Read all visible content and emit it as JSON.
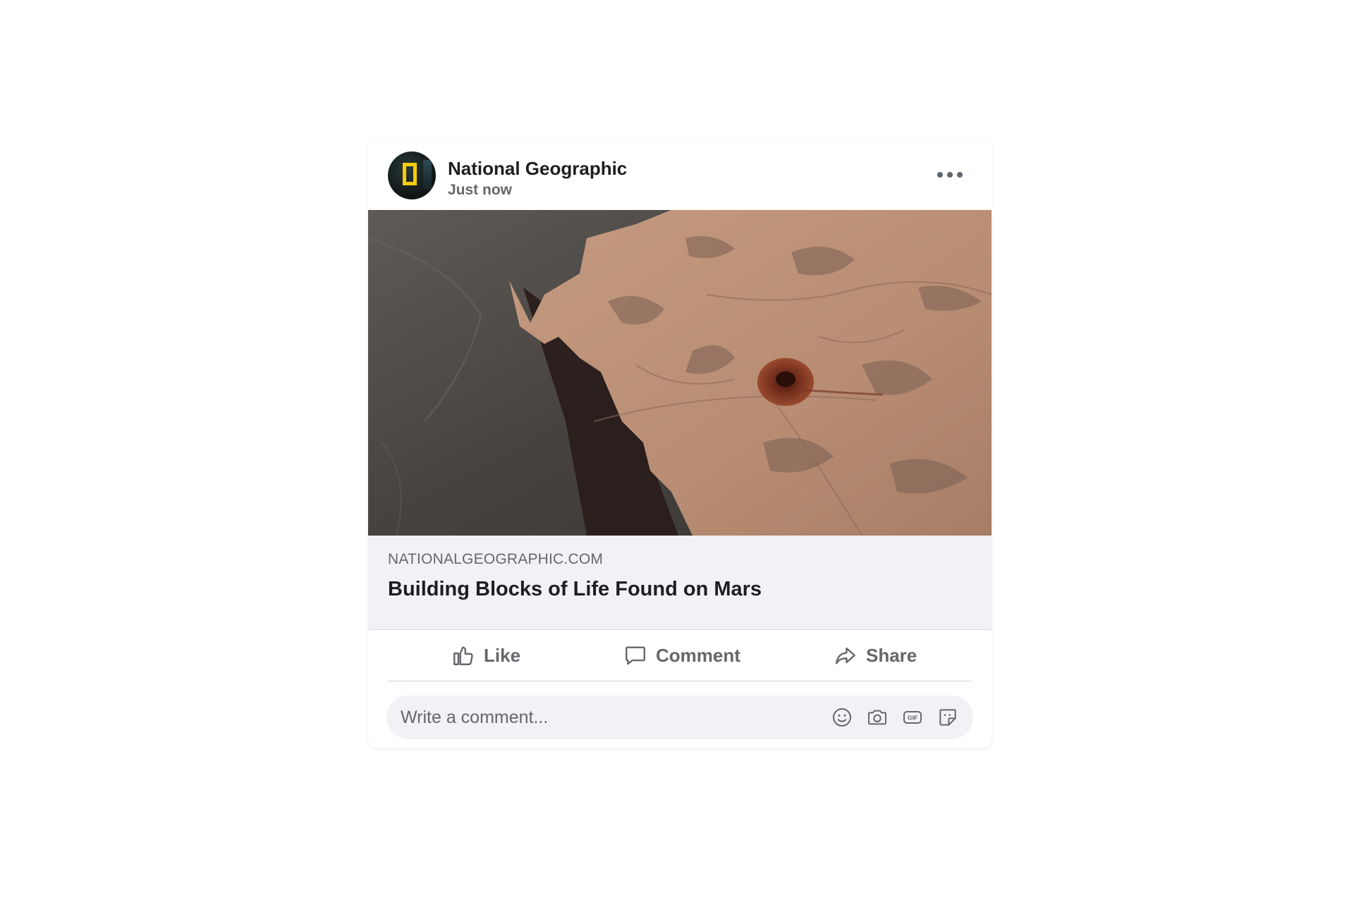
{
  "post": {
    "page_name": "National Geographic",
    "time": "Just now",
    "image_icon": "mars-rock-photo",
    "link": {
      "domain": "NATIONALGEOGRAPHIC.COM",
      "title": "Building Blocks of Life Found on Mars"
    },
    "actions": {
      "like_label": "Like",
      "comment_label": "Comment",
      "share_label": "Share"
    },
    "comment_box": {
      "placeholder": "Write a comment...",
      "value": ""
    },
    "tool_icons": [
      "smiley-icon",
      "camera-icon",
      "gif-icon",
      "sticker-icon"
    ]
  },
  "colors": {
    "brand_yellow": "#f6cd0a",
    "text_primary": "#1c1e21",
    "text_secondary": "#65676b",
    "link_background": "#f0f2f5"
  }
}
